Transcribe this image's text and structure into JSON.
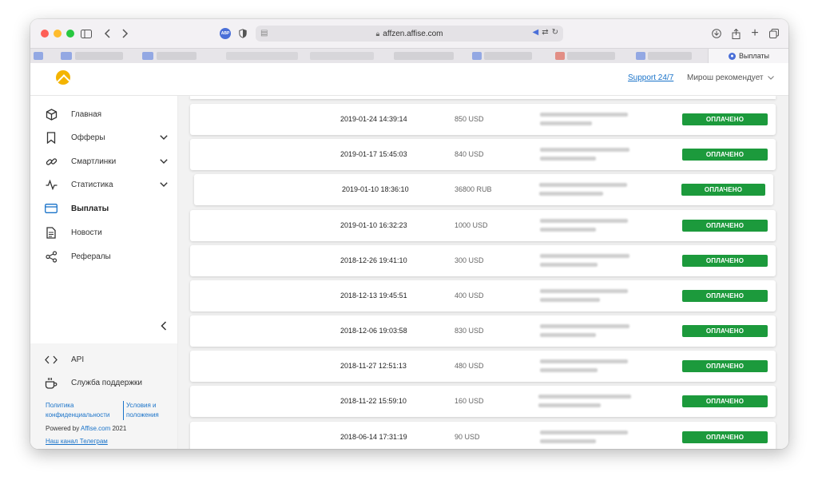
{
  "browser": {
    "url": "affzen.affise.com",
    "profile_tab_label": "Выплаты",
    "abp_label": "ABP"
  },
  "header": {
    "support_link": "Support 24/7",
    "recommend_menu": "Мирош рекомендует"
  },
  "sidebar": {
    "items": [
      {
        "label": "Главная",
        "icon": "cube-icon",
        "has_chevron": false
      },
      {
        "label": "Офферы",
        "icon": "bookmark-icon",
        "has_chevron": true
      },
      {
        "label": "Смартлинки",
        "icon": "link-icon",
        "has_chevron": true
      },
      {
        "label": "Статистика",
        "icon": "pulse-icon",
        "has_chevron": true
      },
      {
        "label": "Выплаты",
        "icon": "card-icon",
        "has_chevron": false,
        "active": true
      },
      {
        "label": "Новости",
        "icon": "document-icon",
        "has_chevron": false
      },
      {
        "label": "Рефералы",
        "icon": "share-icon",
        "has_chevron": false
      }
    ],
    "bottom_items": [
      {
        "label": "API",
        "icon": "code-icon"
      },
      {
        "label": "Служба поддержки",
        "icon": "coffee-icon"
      }
    ],
    "footer": {
      "privacy_line1": "Политика",
      "privacy_line2": "конфиденциальности",
      "terms_line1": "Условия и",
      "terms_line2": "положения",
      "powered_prefix": "Powered by",
      "powered_link": "Affise.com",
      "powered_year": "2021",
      "telegram": "Наш канал Телеграм"
    }
  },
  "payouts": [
    {
      "date": "2019-01-24 14:39:14",
      "amount": "850 USD",
      "status": "ОПЛАЧЕНО"
    },
    {
      "date": "2019-01-17 15:45:03",
      "amount": "840 USD",
      "status": "ОПЛАЧЕНО"
    },
    {
      "date": "2019-01-10 18:36:10",
      "amount": "36800 RUB",
      "status": "ОПЛАЧЕНО"
    },
    {
      "date": "2019-01-10 16:32:23",
      "amount": "1000 USD",
      "status": "ОПЛАЧЕНО"
    },
    {
      "date": "2018-12-26 19:41:10",
      "amount": "300 USD",
      "status": "ОПЛАЧЕНО"
    },
    {
      "date": "2018-12-13 19:45:51",
      "amount": "400 USD",
      "status": "ОПЛАЧЕНО"
    },
    {
      "date": "2018-12-06 19:03:58",
      "amount": "830 USD",
      "status": "ОПЛАЧЕНО"
    },
    {
      "date": "2018-11-27 12:51:13",
      "amount": "480 USD",
      "status": "ОПЛАЧЕНО"
    },
    {
      "date": "2018-11-22 15:59:10",
      "amount": "160 USD",
      "status": "ОПЛАЧЕНО"
    },
    {
      "date": "2018-06-14 17:31:19",
      "amount": "90 USD",
      "status": "ОПЛАЧЕНО"
    }
  ],
  "colors": {
    "status_paid": "#1c9a3c",
    "link": "#1a73c9",
    "logo": "#f4b400"
  }
}
